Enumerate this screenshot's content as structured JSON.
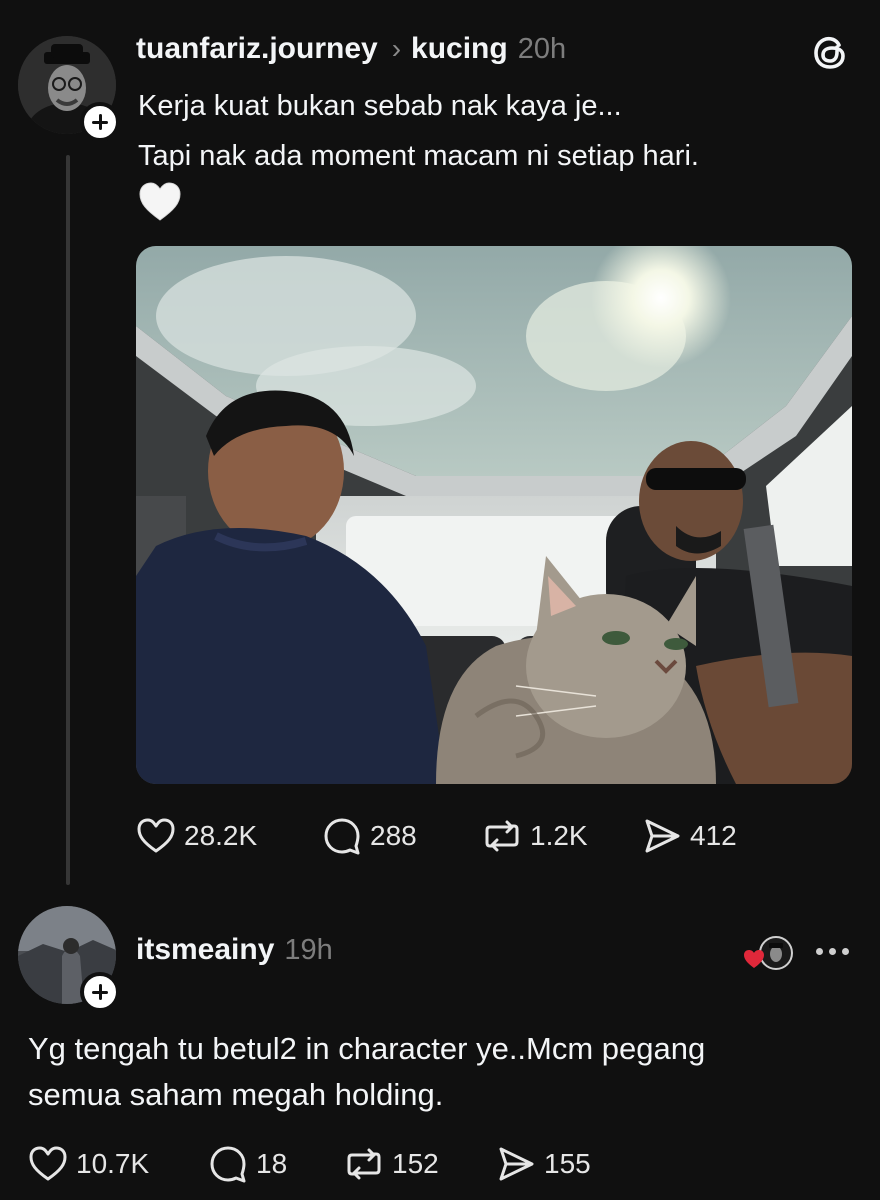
{
  "post": {
    "username": "tuanfariz.journey",
    "separator": "›",
    "topic": "kucing",
    "time": "20h",
    "line1": "Kerja kuat bukan sebab nak kaya je...",
    "line2": "Tapi nak ada moment macam ni setiap hari.",
    "emoji": "white-heart",
    "stats": {
      "likes": "28.2K",
      "comments": "288",
      "reposts": "1.2K",
      "shares": "412"
    }
  },
  "reply": {
    "username": "itsmeainy",
    "time": "19h",
    "line1": "Yg tengah tu betul2 in character ye..Mcm pegang",
    "line2": "semua saham megah holding.",
    "stats": {
      "likes": "10.7K",
      "comments": "18",
      "reposts": "152",
      "shares": "155"
    }
  },
  "colors": {
    "background": "#101010",
    "text": "#f3f5f7",
    "muted": "#7d7d7d",
    "liked_heart": "#e0283a"
  },
  "icons": [
    "threads-logo-icon",
    "heart-icon",
    "comment-icon",
    "repost-icon",
    "share-icon",
    "plus-icon",
    "more-icon"
  ]
}
